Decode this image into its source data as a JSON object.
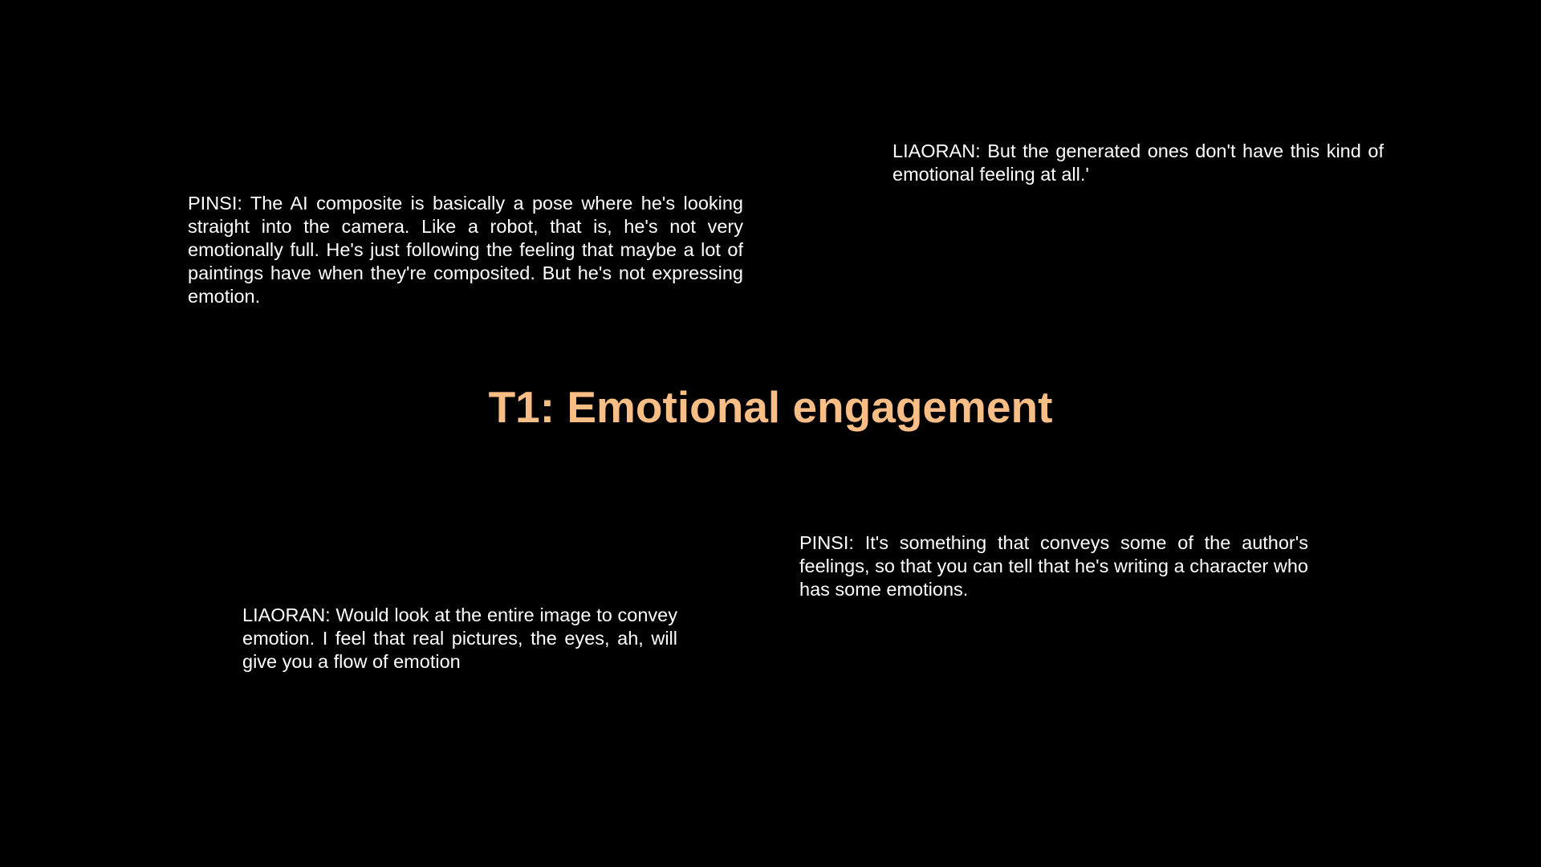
{
  "slide": {
    "title": "T1: Emotional engagement",
    "title_color": "#f9bd86",
    "background_color": "#000000",
    "text_color": "#ffffff",
    "quotes": [
      {
        "text": "PINSI: The AI composite is basically a pose where he's looking straight into the camera. Like a robot, that is, he's not very emotionally full. He's just following the feeling that maybe a lot of paintings have when they're composited. But he's not expressing emotion."
      },
      {
        "text": "LIAORAN: But the generated ones don't have this kind of emotional feeling at all.'"
      },
      {
        "text": "LIAORAN: Would look at the entire image to convey emotion. I feel that real pictures, the eyes, ah, will give you a flow of emotion"
      },
      {
        "text": "PINSI: It's something that conveys some of the author's feelings, so that you can tell that he's writing a character who has some emotions."
      }
    ]
  }
}
